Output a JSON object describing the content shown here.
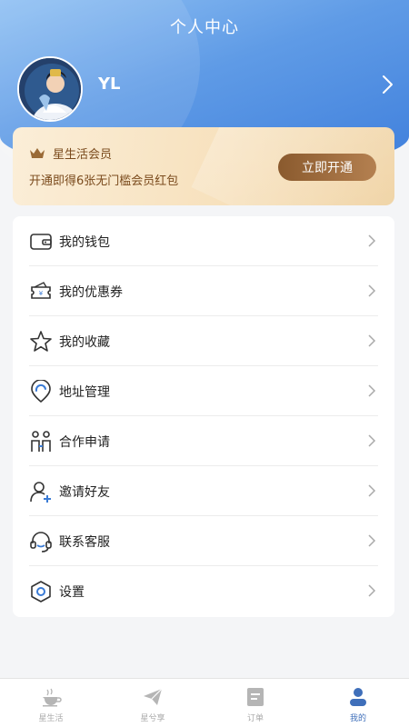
{
  "header": {
    "title": "个人中心",
    "username": "YL"
  },
  "vip": {
    "title": "星生活会员",
    "description": "开通即得6张无门槛会员红包",
    "button_label": "立即开通"
  },
  "menu": {
    "items": [
      {
        "label": "我的钱包",
        "icon": "wallet-icon"
      },
      {
        "label": "我的优惠券",
        "icon": "coupon-icon"
      },
      {
        "label": "我的收藏",
        "icon": "star-icon"
      },
      {
        "label": "地址管理",
        "icon": "location-icon"
      },
      {
        "label": "合作申请",
        "icon": "partners-icon"
      },
      {
        "label": "邀请好友",
        "icon": "invite-user-icon"
      },
      {
        "label": "联系客服",
        "icon": "headset-icon"
      },
      {
        "label": "设置",
        "icon": "settings-icon"
      }
    ]
  },
  "tabbar": {
    "tabs": [
      {
        "label": "星生活",
        "icon": "coffee-icon"
      },
      {
        "label": "星兮享",
        "icon": "send-icon"
      },
      {
        "label": "订单",
        "icon": "order-icon"
      },
      {
        "label": "我的",
        "icon": "profile-icon"
      }
    ],
    "active_index": 3
  },
  "colors": {
    "header_blue": "#3f7fdc",
    "gold_text": "#7a4a1c",
    "vip_button": "#8a5a2e",
    "active_tab": "#3f6fba"
  }
}
